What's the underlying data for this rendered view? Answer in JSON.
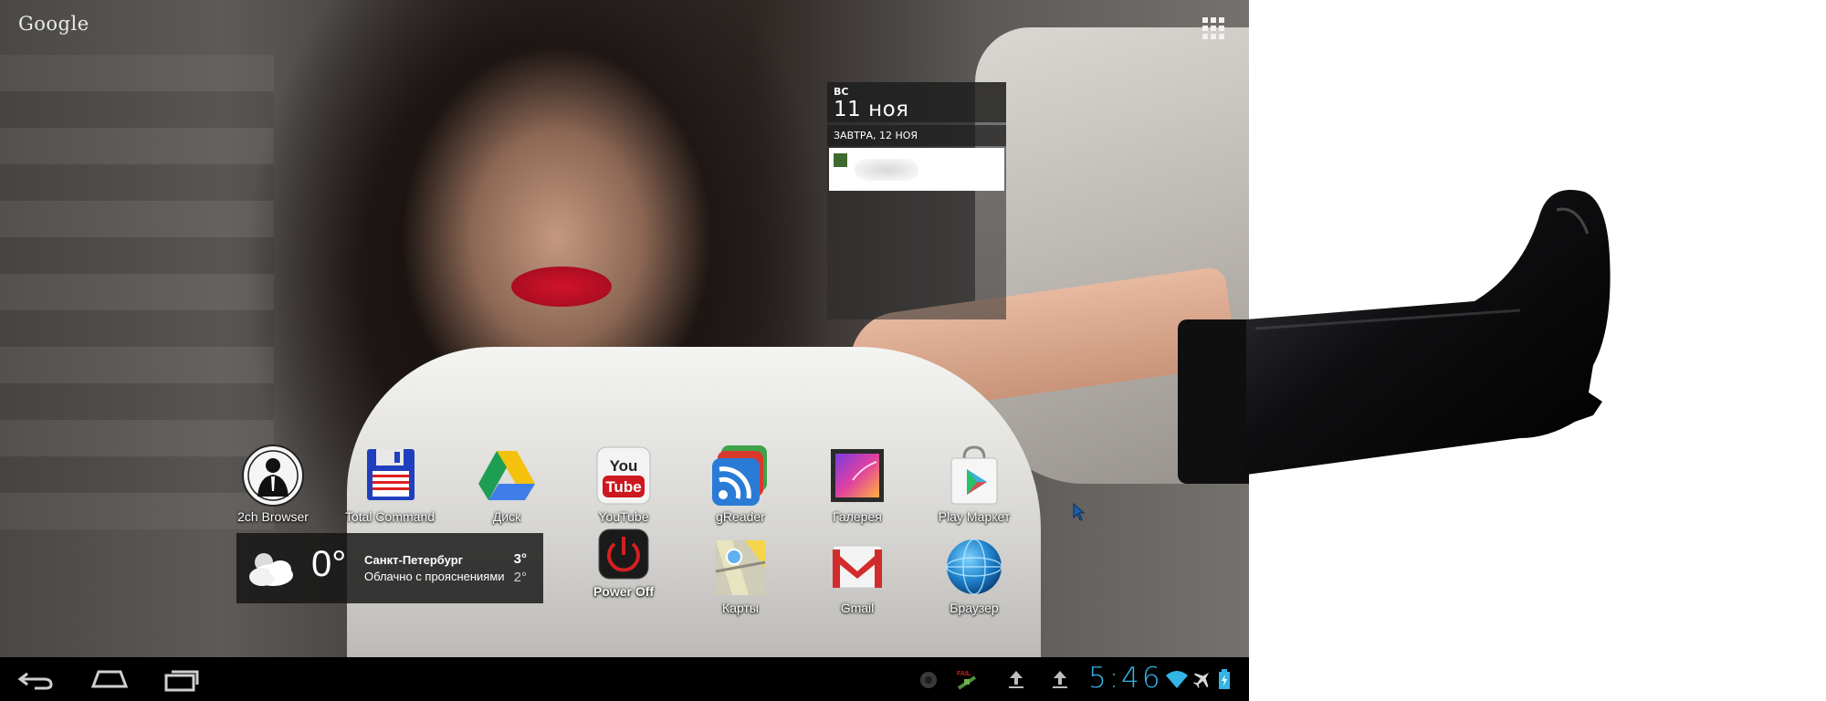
{
  "launcher": {
    "search_logo": "Google",
    "apps_button_icon": "all-apps-grid-icon"
  },
  "calendar": {
    "day_of_week": "ВС",
    "date": "11 ноя",
    "tomorrow_header": "ЗАВТРА, 12 НОЯ",
    "event_color": "#3f6a2f"
  },
  "apps": [
    {
      "label": "2ch Browser",
      "icon": "anonymous-mask-icon"
    },
    {
      "label": "Total Command",
      "icon": "floppy-disk-icon"
    },
    {
      "label": "Диск",
      "icon": "google-drive-icon"
    },
    {
      "label": "YouTube",
      "icon": "youtube-icon"
    },
    {
      "label": "gReader",
      "icon": "rss-feed-icon"
    },
    {
      "label": "Галерея",
      "icon": "gallery-icon"
    },
    {
      "label": "Play Маркет",
      "icon": "play-store-icon"
    },
    {
      "label": "Power Off",
      "icon": "power-icon"
    },
    {
      "label": "Карты",
      "icon": "maps-icon"
    },
    {
      "label": "Gmail",
      "icon": "gmail-icon"
    },
    {
      "label": "Браузер",
      "icon": "globe-browser-icon"
    }
  ],
  "weather": {
    "temperature": "0°",
    "city": "Санкт-Петербург",
    "condition": "Облачно с прояснениями",
    "high": "3°",
    "low": "2°",
    "icon": "partly-cloudy-icon"
  },
  "system_bar": {
    "back_icon": "back-icon",
    "home_icon": "home-icon",
    "recents_icon": "recent-apps-icon",
    "notification_icons": [
      "record-dot-icon",
      "satellite-fail-icon",
      "upload-icon",
      "upload-icon"
    ],
    "clock": "5:46",
    "clock_color": "#33b5e5",
    "status_icons": [
      "wifi-icon",
      "airplane-mode-icon",
      "battery-charging-icon"
    ]
  }
}
